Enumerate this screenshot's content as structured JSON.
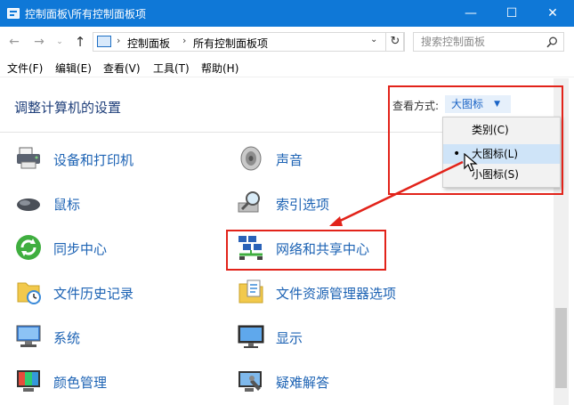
{
  "window": {
    "title": "控制面板\\所有控制面板项",
    "minimize_glyph": "—",
    "maximize_glyph": "☐",
    "close_glyph": "✕"
  },
  "nav": {
    "back_glyph": "←",
    "forward_glyph": "→",
    "history_glyph": "⌄",
    "up_glyph": "↑",
    "refresh_glyph": "↻",
    "address_separator": "›",
    "address_dropdown_glyph": "⌄",
    "breadcrumbs": [
      "控制面板",
      "所有控制面板项"
    ],
    "search_placeholder": "搜索控制面板",
    "search_icon": "search-icon"
  },
  "menu": [
    {
      "label": "文件(F)"
    },
    {
      "label": "编辑(E)"
    },
    {
      "label": "查看(V)"
    },
    {
      "label": "工具(T)"
    },
    {
      "label": "帮助(H)"
    }
  ],
  "header": {
    "title": "调整计算机的设置",
    "view_by_label": "查看方式:",
    "view_by_value": "大图标",
    "caret_glyph": "▼"
  },
  "view_options": [
    {
      "label": "类别(C)",
      "selected": false
    },
    {
      "label": "大图标(L)",
      "selected": true
    },
    {
      "label": "小图标(S)",
      "selected": false
    }
  ],
  "selected_marker": "•",
  "items": [
    {
      "label": "设备和打印机",
      "icon": "printer-icon"
    },
    {
      "label": "声音",
      "icon": "speaker-icon"
    },
    {
      "label": "鼠标",
      "icon": "mouse-icon"
    },
    {
      "label": "索引选项",
      "icon": "index-magnifier-icon"
    },
    {
      "label": "同步中心",
      "icon": "sync-icon"
    },
    {
      "label": "网络和共享中心",
      "icon": "network-icon"
    },
    {
      "label": "文件历史记录",
      "icon": "file-history-icon"
    },
    {
      "label": "文件资源管理器选项",
      "icon": "folder-options-icon"
    },
    {
      "label": "系统",
      "icon": "system-icon"
    },
    {
      "label": "显示",
      "icon": "display-icon"
    },
    {
      "label": "颜色管理",
      "icon": "color-management-icon"
    },
    {
      "label": "疑难解答",
      "icon": "troubleshooting-icon"
    }
  ],
  "colors": {
    "titlebar": "#0f78d7",
    "link": "#1d63b4",
    "annotation": "#e2231a",
    "selection": "#cfe4f8"
  }
}
